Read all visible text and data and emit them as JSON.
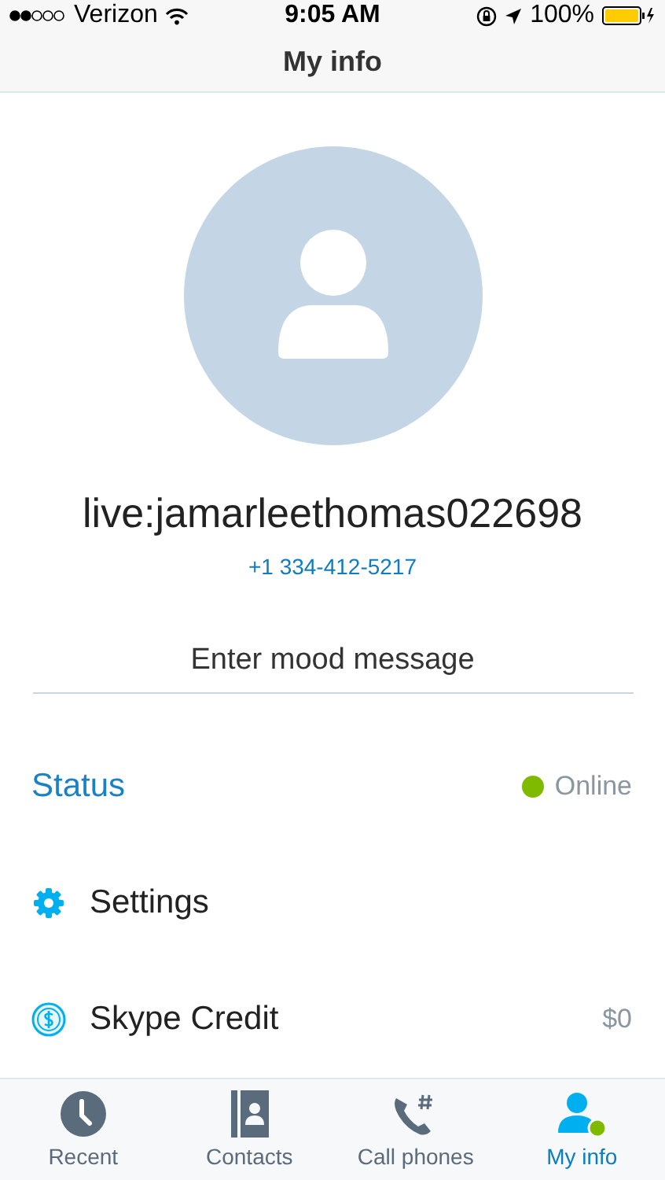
{
  "status_bar": {
    "carrier": "Verizon",
    "time": "9:05 AM",
    "battery": "100%"
  },
  "nav": {
    "title": "My info"
  },
  "profile": {
    "name": "live:jamarleethomas022698",
    "phone": "+1 334-412-5217"
  },
  "mood": {
    "placeholder": "Enter mood message"
  },
  "rows": [
    {
      "kind": "status",
      "label": "Status",
      "value": "Online"
    },
    {
      "kind": "settings",
      "label": "Settings"
    },
    {
      "kind": "credit",
      "label": "Skype Credit",
      "value": "$0"
    }
  ],
  "tabs": [
    {
      "kind": "clock",
      "label": "Recent",
      "selected": false
    },
    {
      "kind": "contacts",
      "label": "Contacts",
      "selected": false
    },
    {
      "kind": "phone",
      "label": "Call phones",
      "selected": false
    },
    {
      "kind": "person",
      "label": "My info",
      "selected": true
    }
  ]
}
